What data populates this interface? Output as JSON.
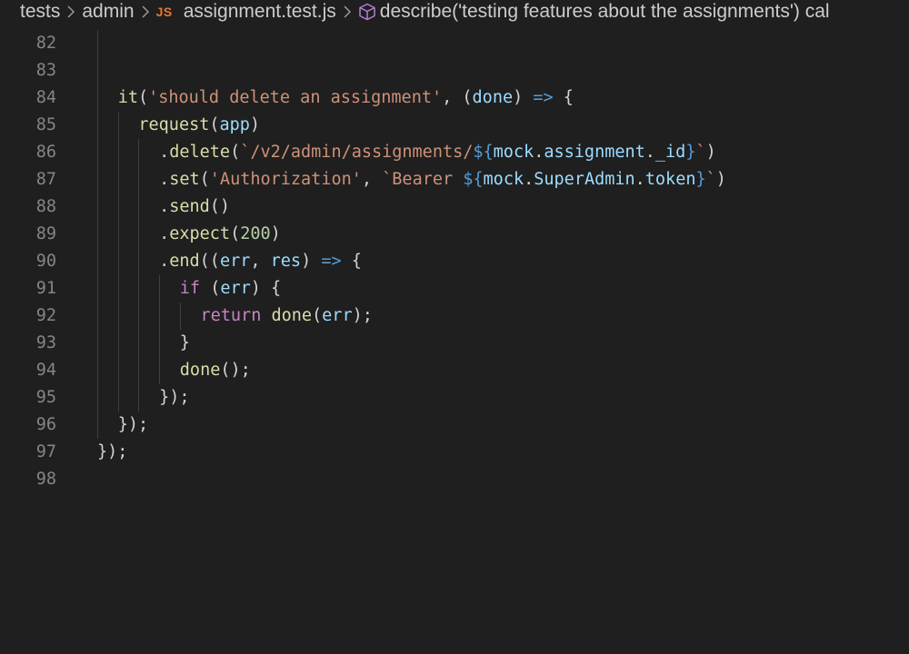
{
  "breadcrumb": {
    "items": [
      "tests",
      "admin",
      "assignment.test.js",
      "describe('testing features about the assignments') cal"
    ],
    "file_badge": "JS"
  },
  "editor": {
    "lines": [
      {
        "num": "82",
        "indent": 1,
        "tokens": []
      },
      {
        "num": "83",
        "indent": 1,
        "tokens": []
      },
      {
        "num": "84",
        "indent": 1,
        "tokens": [
          {
            "t": "it",
            "c": "fn"
          },
          {
            "t": "(",
            "c": "pun"
          },
          {
            "t": "'should delete an assignment'",
            "c": "str"
          },
          {
            "t": ", (",
            "c": "pun"
          },
          {
            "t": "done",
            "c": "var"
          },
          {
            "t": ") ",
            "c": "pun"
          },
          {
            "t": "=>",
            "c": "arrow"
          },
          {
            "t": " {",
            "c": "pun"
          }
        ]
      },
      {
        "num": "85",
        "indent": 2,
        "tokens": [
          {
            "t": "request",
            "c": "fn"
          },
          {
            "t": "(",
            "c": "pun"
          },
          {
            "t": "app",
            "c": "var"
          },
          {
            "t": ")",
            "c": "pun"
          }
        ]
      },
      {
        "num": "86",
        "indent": 3,
        "tokens": [
          {
            "t": ".",
            "c": "pun"
          },
          {
            "t": "delete",
            "c": "fn"
          },
          {
            "t": "(",
            "c": "pun"
          },
          {
            "t": "`/v2/admin/assignments/",
            "c": "str"
          },
          {
            "t": "${",
            "c": "tmpl"
          },
          {
            "t": "mock",
            "c": "var"
          },
          {
            "t": ".",
            "c": "pun"
          },
          {
            "t": "assignment",
            "c": "var"
          },
          {
            "t": ".",
            "c": "pun"
          },
          {
            "t": "_id",
            "c": "var"
          },
          {
            "t": "}",
            "c": "tmpl"
          },
          {
            "t": "`",
            "c": "str"
          },
          {
            "t": ")",
            "c": "pun"
          }
        ]
      },
      {
        "num": "87",
        "indent": 3,
        "tokens": [
          {
            "t": ".",
            "c": "pun"
          },
          {
            "t": "set",
            "c": "fn"
          },
          {
            "t": "(",
            "c": "pun"
          },
          {
            "t": "'Authorization'",
            "c": "str"
          },
          {
            "t": ", ",
            "c": "pun"
          },
          {
            "t": "`Bearer ",
            "c": "str"
          },
          {
            "t": "${",
            "c": "tmpl"
          },
          {
            "t": "mock",
            "c": "var"
          },
          {
            "t": ".",
            "c": "pun"
          },
          {
            "t": "SuperAdmin",
            "c": "var"
          },
          {
            "t": ".",
            "c": "pun"
          },
          {
            "t": "token",
            "c": "var"
          },
          {
            "t": "}",
            "c": "tmpl"
          },
          {
            "t": "`",
            "c": "str"
          },
          {
            "t": ")",
            "c": "pun"
          }
        ]
      },
      {
        "num": "88",
        "indent": 3,
        "tokens": [
          {
            "t": ".",
            "c": "pun"
          },
          {
            "t": "send",
            "c": "fn"
          },
          {
            "t": "()",
            "c": "pun"
          }
        ]
      },
      {
        "num": "89",
        "indent": 3,
        "tokens": [
          {
            "t": ".",
            "c": "pun"
          },
          {
            "t": "expect",
            "c": "fn"
          },
          {
            "t": "(",
            "c": "pun"
          },
          {
            "t": "200",
            "c": "num"
          },
          {
            "t": ")",
            "c": "pun"
          }
        ]
      },
      {
        "num": "90",
        "indent": 3,
        "tokens": [
          {
            "t": ".",
            "c": "pun"
          },
          {
            "t": "end",
            "c": "fn"
          },
          {
            "t": "((",
            "c": "pun"
          },
          {
            "t": "err",
            "c": "var"
          },
          {
            "t": ", ",
            "c": "pun"
          },
          {
            "t": "res",
            "c": "var"
          },
          {
            "t": ") ",
            "c": "pun"
          },
          {
            "t": "=>",
            "c": "arrow"
          },
          {
            "t": " {",
            "c": "pun"
          }
        ]
      },
      {
        "num": "91",
        "indent": 4,
        "tokens": [
          {
            "t": "if",
            "c": "kw"
          },
          {
            "t": " (",
            "c": "pun"
          },
          {
            "t": "err",
            "c": "var"
          },
          {
            "t": ") {",
            "c": "pun"
          }
        ]
      },
      {
        "num": "92",
        "indent": 5,
        "tokens": [
          {
            "t": "return",
            "c": "kw"
          },
          {
            "t": " ",
            "c": "pun"
          },
          {
            "t": "done",
            "c": "fn"
          },
          {
            "t": "(",
            "c": "pun"
          },
          {
            "t": "err",
            "c": "var"
          },
          {
            "t": ");",
            "c": "pun"
          }
        ]
      },
      {
        "num": "93",
        "indent": 4,
        "tokens": [
          {
            "t": "}",
            "c": "pun"
          }
        ]
      },
      {
        "num": "94",
        "indent": 4,
        "tokens": [
          {
            "t": "done",
            "c": "fn"
          },
          {
            "t": "();",
            "c": "pun"
          }
        ]
      },
      {
        "num": "95",
        "indent": 3,
        "tokens": [
          {
            "t": "});",
            "c": "pun"
          }
        ]
      },
      {
        "num": "96",
        "indent": 1,
        "tokens": [
          {
            "t": "});",
            "c": "pun"
          }
        ]
      },
      {
        "num": "97",
        "indent": 0,
        "tokens": [
          {
            "t": "});",
            "c": "pun"
          }
        ]
      },
      {
        "num": "98",
        "indent": 0,
        "tokens": []
      }
    ]
  }
}
